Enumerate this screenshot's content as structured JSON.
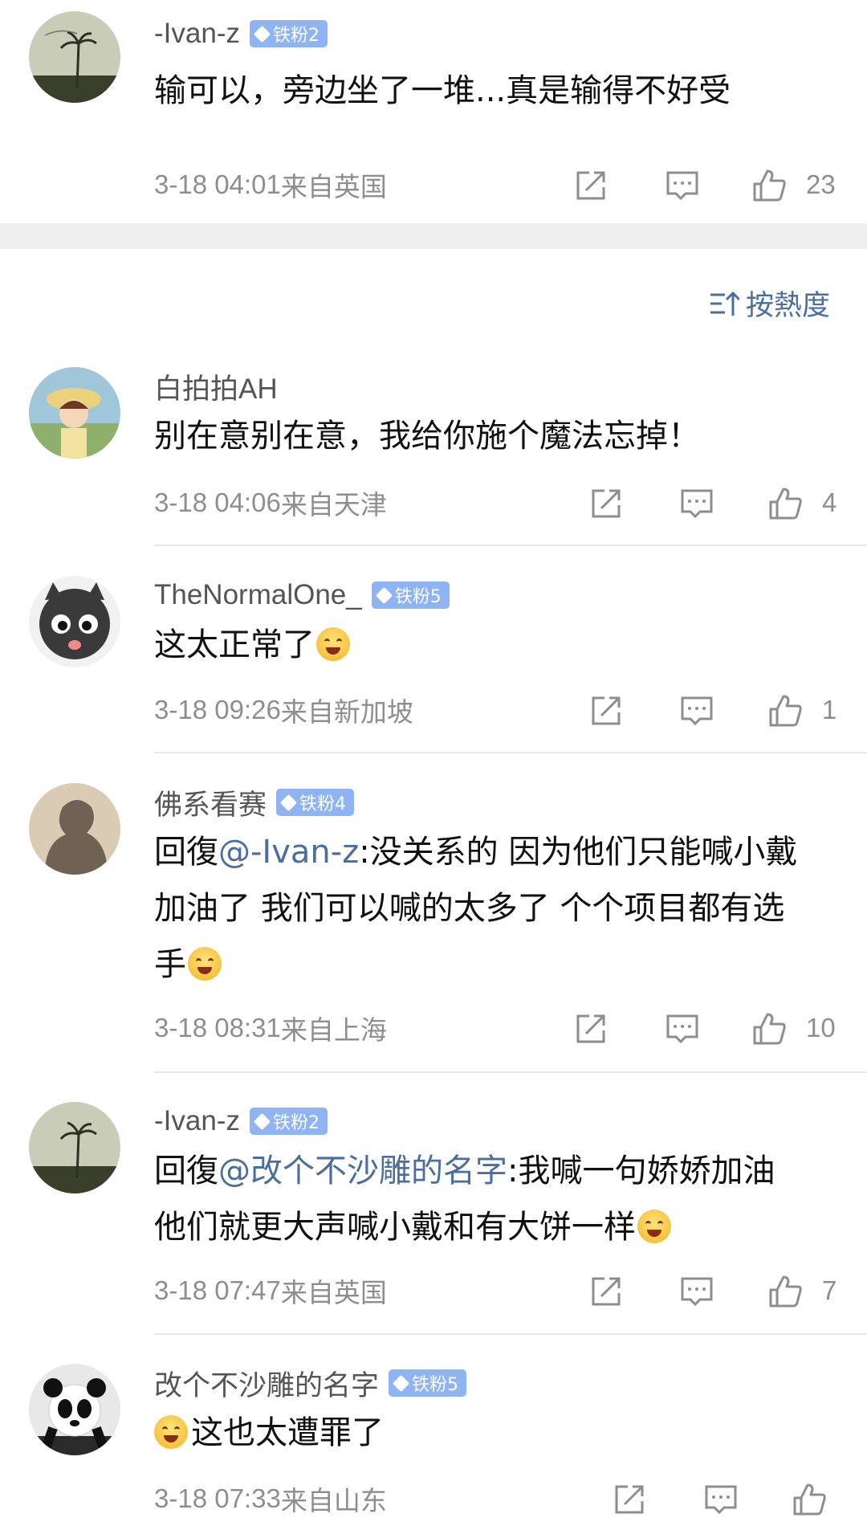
{
  "top_comment": {
    "username": "-Ivan-z",
    "badge": "铁粉2",
    "text": "输可以，旁边坐了一堆...真是输得不好受",
    "time": "3-18 04:01",
    "location": "来自英国",
    "likes": "23"
  },
  "sort_label": "按熱度",
  "comments": [
    {
      "username": "白拍拍AH",
      "badge": "",
      "text": "别在意别在意，我给你施个魔法忘掉！",
      "time": "3-18 04:06",
      "location": "来自天津",
      "likes": "4"
    },
    {
      "username": "TheNormalOne_",
      "badge": "铁粉5",
      "text": "这太正常了",
      "emoji": "laugh-cry",
      "time": "3-18 09:26",
      "location": "来自新加坡",
      "likes": "1"
    },
    {
      "username": "佛系看赛",
      "badge": "铁粉4",
      "reply_prefix": "回復",
      "mention": "@-Ivan-z",
      "text_line1": ":没关系的 因为他们只能喊小戴",
      "text_line2": "加油了 我们可以喊的太多了 个个项目都有选",
      "text_line3": "手",
      "emoji": "laugh-cry",
      "time": "3-18 08:31",
      "location": "来自上海",
      "likes": "10"
    },
    {
      "username": "-Ivan-z",
      "badge": "铁粉2",
      "reply_prefix": "回復",
      "mention": "@改个不沙雕的名字",
      "text_line1": ":我喊一句娇娇加油",
      "text_line2": "他们就更大声喊小戴和有大饼一样",
      "emoji": "sweat-smile",
      "time": "3-18 07:47",
      "location": "来自英国",
      "likes": "7"
    },
    {
      "username": "改个不沙雕的名字",
      "badge": "铁粉5",
      "emoji": "shocked",
      "text": "这也太遭罪了",
      "time": "3-18 07:33",
      "location": "来自山东",
      "likes": ""
    }
  ],
  "colors": {
    "mention": "#4a6e9e",
    "badge": "#8fb4f3",
    "meta": "#8e8e8e",
    "separator_band": "#efefef"
  },
  "icons": [
    "share-icon",
    "comment-icon",
    "like-icon",
    "sort-icon",
    "badge-diamond-icon"
  ]
}
